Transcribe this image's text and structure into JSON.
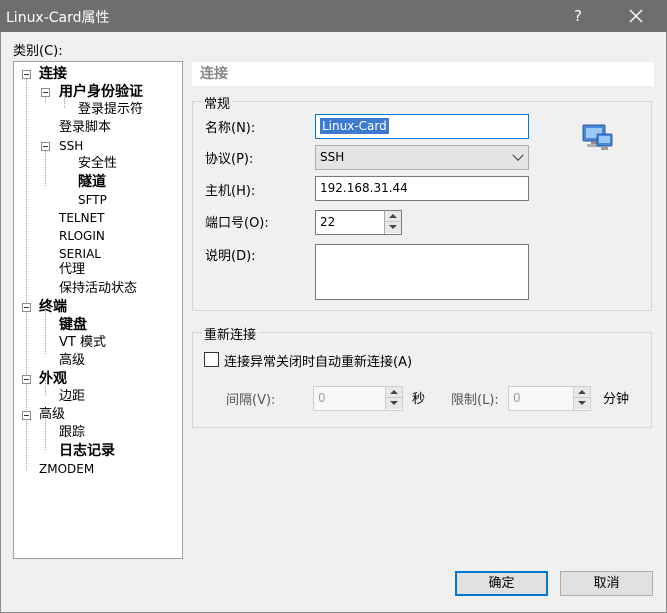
{
  "window": {
    "title": "Linux-Card属性",
    "help": "?"
  },
  "category_label": "类别(C):",
  "tree": {
    "items": [
      {
        "label": "连接"
      },
      {
        "label": "用户身份验证"
      },
      {
        "label": "登录提示符"
      },
      {
        "label": "登录脚本"
      },
      {
        "label": "SSH"
      },
      {
        "label": "安全性"
      },
      {
        "label": "隧道"
      },
      {
        "label": "SFTP"
      },
      {
        "label": "TELNET"
      },
      {
        "label": "RLOGIN"
      },
      {
        "label": "SERIAL"
      },
      {
        "label": "代理"
      },
      {
        "label": "保持活动状态"
      },
      {
        "label": "终端"
      },
      {
        "label": "键盘"
      },
      {
        "label": "VT 模式"
      },
      {
        "label": "高级"
      },
      {
        "label": "外观"
      },
      {
        "label": "边距"
      },
      {
        "label": "高级"
      },
      {
        "label": "跟踪"
      },
      {
        "label": "日志记录"
      },
      {
        "label": "ZMODEM"
      }
    ]
  },
  "section_header": "连接",
  "general": {
    "title": "常规",
    "name_label": "名称(N):",
    "name_value": "Linux-Card",
    "protocol_label": "协议(P):",
    "protocol_value": "SSH",
    "host_label": "主机(H):",
    "host_value": "192.168.31.44",
    "port_label": "端口号(O):",
    "port_value": "22",
    "desc_label": "说明(D):",
    "desc_value": ""
  },
  "reconnect": {
    "title": "重新连接",
    "checkbox_label": "连接异常关闭时自动重新连接(A)",
    "checked": false,
    "interval_label": "间隔(V):",
    "interval_value": "0",
    "seconds_unit": "秒",
    "limit_label": "限制(L):",
    "limit_value": "0",
    "minutes_unit": "分钟"
  },
  "buttons": {
    "ok": "确定",
    "cancel": "取消"
  },
  "icons": {
    "connection": "network-computers-icon",
    "close": "close-icon"
  },
  "colors": {
    "titlebar": "#6e6e6e",
    "accent": "#0078d7",
    "selection": "#3d7bd1"
  }
}
